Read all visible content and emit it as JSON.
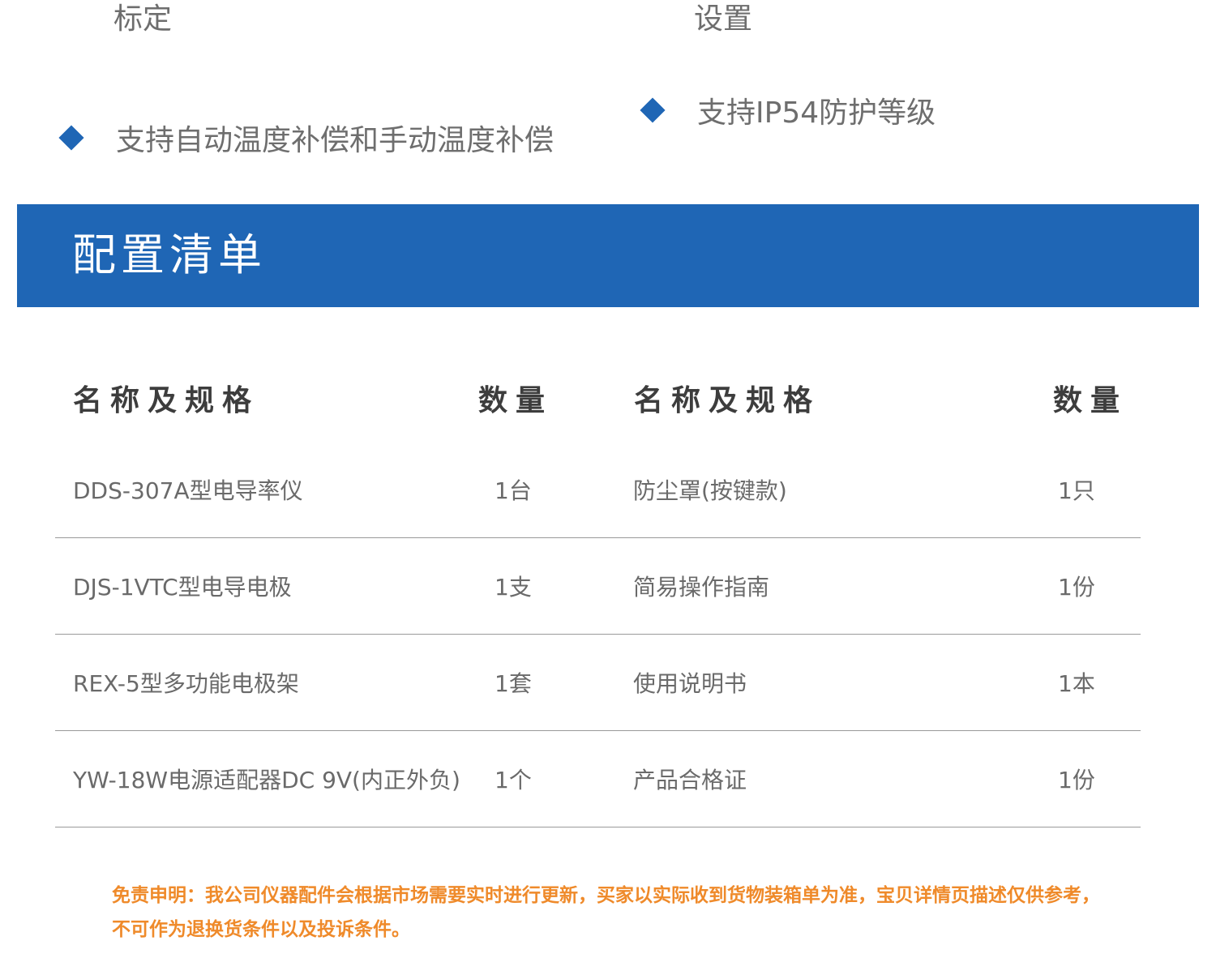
{
  "features": {
    "frag_left": "标定",
    "frag_right": "设置",
    "left": "支持自动温度补偿和手动温度补偿",
    "right": "支持IP54防护等级"
  },
  "section": {
    "title": "配置清单"
  },
  "table": {
    "headers": [
      "名称及规格",
      "数量",
      "名称及规格",
      "数量"
    ],
    "rows": [
      {
        "name1": "DDS-307A型电导率仪",
        "qty1": "1台",
        "name2": "防尘罩(按键款)",
        "qty2": "1只"
      },
      {
        "name1": "DJS-1VTC型电导电极",
        "qty1": "1支",
        "name2": "简易操作指南",
        "qty2": "1份"
      },
      {
        "name1": "REX-5型多功能电极架",
        "qty1": "1套",
        "name2": "使用说明书",
        "qty2": "1本"
      },
      {
        "name1": "YW-18W电源适配器DC 9V(内正外负)",
        "qty1": "1个",
        "name2": "产品合格证",
        "qty2": "1份"
      }
    ]
  },
  "disclaimer": "免责申明：我公司仪器配件会根据市场需要实时进行更新，买家以实际收到货物装箱单为准，宝贝详情页描述仅供参考，不可作为退换货条件以及投诉条件。",
  "colors": {
    "accent_blue": "#1f66b5",
    "disclaimer_orange": "#ef8a2a"
  }
}
